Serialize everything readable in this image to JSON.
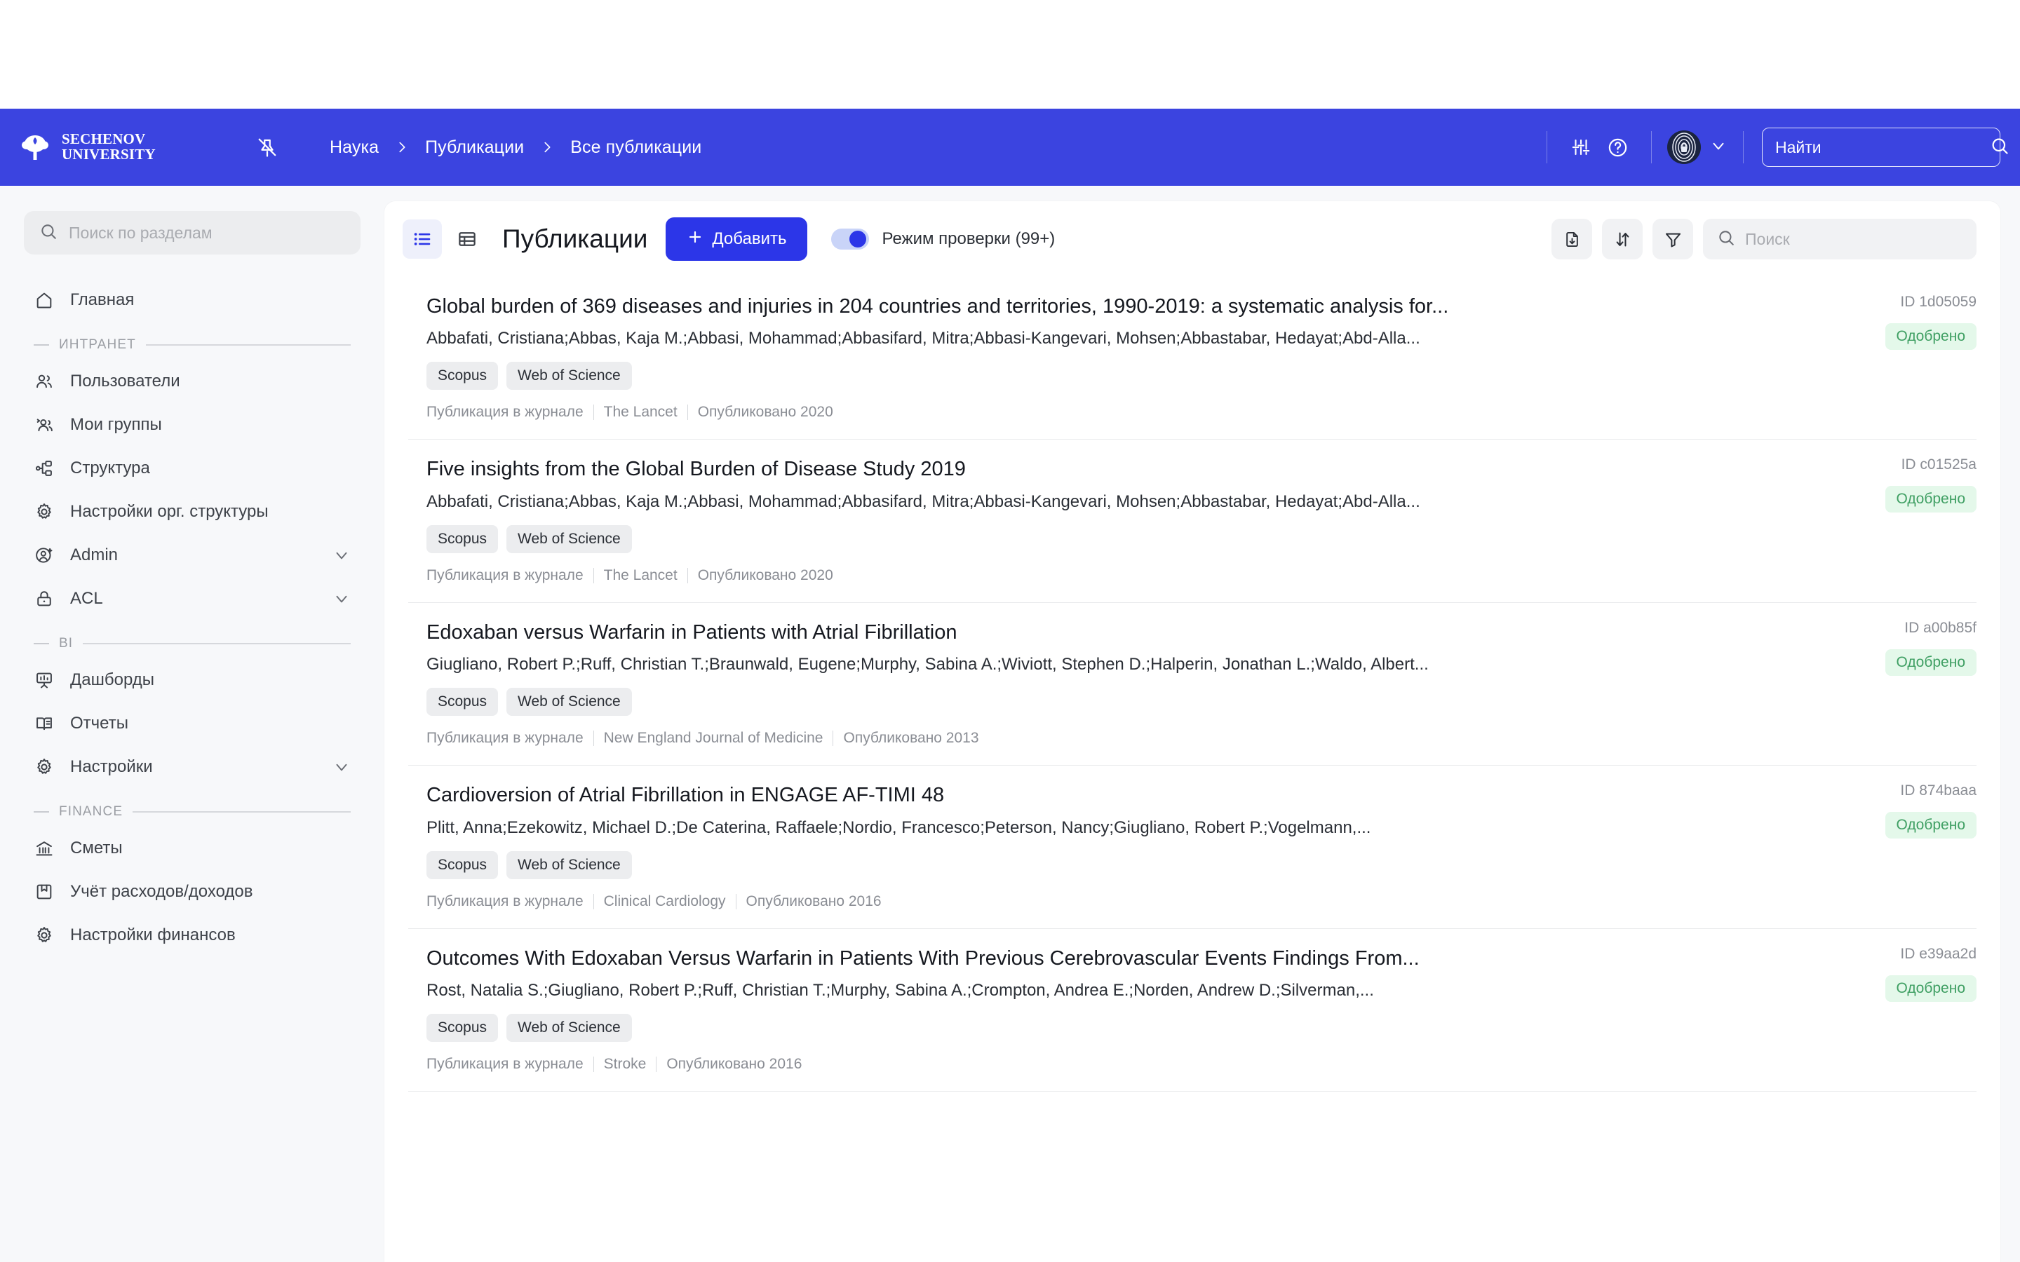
{
  "brand": {
    "logo_line1": "SECHENOV",
    "logo_line2": "UNIVERSITY",
    "accent_blue": "#3B44E0",
    "button_blue": "#2C36E8",
    "approved_green": "#3F9F63",
    "approved_bg": "#E4F8EA"
  },
  "header": {
    "pin_icon": "pin-off-icon",
    "breadcrumbs": [
      {
        "label": "Наука"
      },
      {
        "label": "Публикации"
      },
      {
        "label": "Все публикации"
      }
    ],
    "settings_icon": "sliders-icon",
    "help_icon": "help-circle-icon",
    "avatar_icon": "fingerprint-avatar",
    "chevron_icon": "chevron-down-icon",
    "search": {
      "placeholder": "Найти",
      "value": "",
      "icon": "search-icon"
    }
  },
  "sidebar": {
    "search": {
      "placeholder": "Поиск по разделам",
      "value": "",
      "icon": "search-icon"
    },
    "top_items": [
      {
        "label": "Главная",
        "icon": "home-icon",
        "expandable": false
      }
    ],
    "sections": [
      {
        "title": "ИНТРАНЕТ",
        "items": [
          {
            "label": "Пользователи",
            "icon": "users-icon",
            "expandable": false
          },
          {
            "label": "Мои группы",
            "icon": "user-group-icon",
            "expandable": false
          },
          {
            "label": "Структура",
            "icon": "sitemap-icon",
            "expandable": false
          },
          {
            "label": "Настройки орг. структуры",
            "icon": "gear-icon",
            "expandable": false
          },
          {
            "label": "Admin",
            "icon": "user-cog-icon",
            "expandable": true
          },
          {
            "label": "ACL",
            "icon": "lock-icon",
            "expandable": true
          }
        ]
      },
      {
        "title": "BI",
        "items": [
          {
            "label": "Дашборды",
            "icon": "dashboard-icon",
            "expandable": false
          },
          {
            "label": "Отчеты",
            "icon": "book-icon",
            "expandable": false
          },
          {
            "label": "Настройки",
            "icon": "gear-icon",
            "expandable": true
          }
        ]
      },
      {
        "title": "FINANCE",
        "items": [
          {
            "label": "Сметы",
            "icon": "bank-icon",
            "expandable": false
          },
          {
            "label": "Учёт расходов/доходов",
            "icon": "ledger-icon",
            "expandable": false
          },
          {
            "label": "Настройки финансов",
            "icon": "gear-icon",
            "expandable": false
          }
        ]
      }
    ]
  },
  "toolbar": {
    "view_list_icon": "list-view-icon",
    "view_table_icon": "table-view-icon",
    "active_view": "list",
    "title": "Публикации",
    "add_label": "Добавить",
    "add_icon": "plus-icon",
    "check_mode_label": "Режим проверки (99+)",
    "check_mode_on": true,
    "export_icon": "file-download-icon",
    "sort_icon": "sort-arrows-icon",
    "filter_icon": "filter-icon",
    "search": {
      "placeholder": "Поиск",
      "value": "",
      "icon": "search-icon"
    }
  },
  "publications": [
    {
      "title": "Global burden of 369 diseases and injuries in 204 countries and territories, 1990-2019: a systematic analysis for...",
      "authors": "Abbafati, Cristiana;Abbas, Kaja M.;Abbasi, Mohammad;Abbasifard, Mitra;Abbasi-Kangevari, Mohsen;Abbastabar, Hedayat;Abd-Alla...",
      "tags": [
        "Scopus",
        "Web of Science"
      ],
      "type": "Публикация в журнале",
      "journal": "The Lancet",
      "published": "Опубликовано 2020",
      "id": "ID 1d05059",
      "status": "Одобрено"
    },
    {
      "title": "Five insights from the Global Burden of Disease Study 2019",
      "authors": "Abbafati, Cristiana;Abbas, Kaja M.;Abbasi, Mohammad;Abbasifard, Mitra;Abbasi-Kangevari, Mohsen;Abbastabar, Hedayat;Abd-Alla...",
      "tags": [
        "Scopus",
        "Web of Science"
      ],
      "type": "Публикация в журнале",
      "journal": "The Lancet",
      "published": "Опубликовано 2020",
      "id": "ID c01525a",
      "status": "Одобрено"
    },
    {
      "title": "Edoxaban versus Warfarin in Patients with Atrial Fibrillation",
      "authors": "Giugliano, Robert P.;Ruff, Christian T.;Braunwald, Eugene;Murphy, Sabina A.;Wiviott, Stephen D.;Halperin, Jonathan L.;Waldo, Albert...",
      "tags": [
        "Scopus",
        "Web of Science"
      ],
      "type": "Публикация в журнале",
      "journal": "New England Journal of Medicine",
      "published": "Опубликовано 2013",
      "id": "ID a00b85f",
      "status": "Одобрено"
    },
    {
      "title": "Cardioversion of Atrial Fibrillation in ENGAGE AF-TIMI 48",
      "authors": "Plitt, Anna;Ezekowitz, Michael D.;De Caterina, Raffaele;Nordio, Francesco;Peterson, Nancy;Giugliano, Robert P.;Vogelmann,...",
      "tags": [
        "Scopus",
        "Web of Science"
      ],
      "type": "Публикация в журнале",
      "journal": "Clinical Cardiology",
      "published": "Опубликовано 2016",
      "id": "ID 874baaa",
      "status": "Одобрено"
    },
    {
      "title": "Outcomes With Edoxaban Versus Warfarin in Patients With Previous Cerebrovascular Events Findings From...",
      "authors": "Rost, Natalia S.;Giugliano, Robert P.;Ruff, Christian T.;Murphy, Sabina A.;Crompton, Andrea E.;Norden, Andrew D.;Silverman,...",
      "tags": [
        "Scopus",
        "Web of Science"
      ],
      "type": "Публикация в журнале",
      "journal": "Stroke",
      "published": "Опубликовано 2016",
      "id": "ID e39aa2d",
      "status": "Одобрено"
    }
  ]
}
